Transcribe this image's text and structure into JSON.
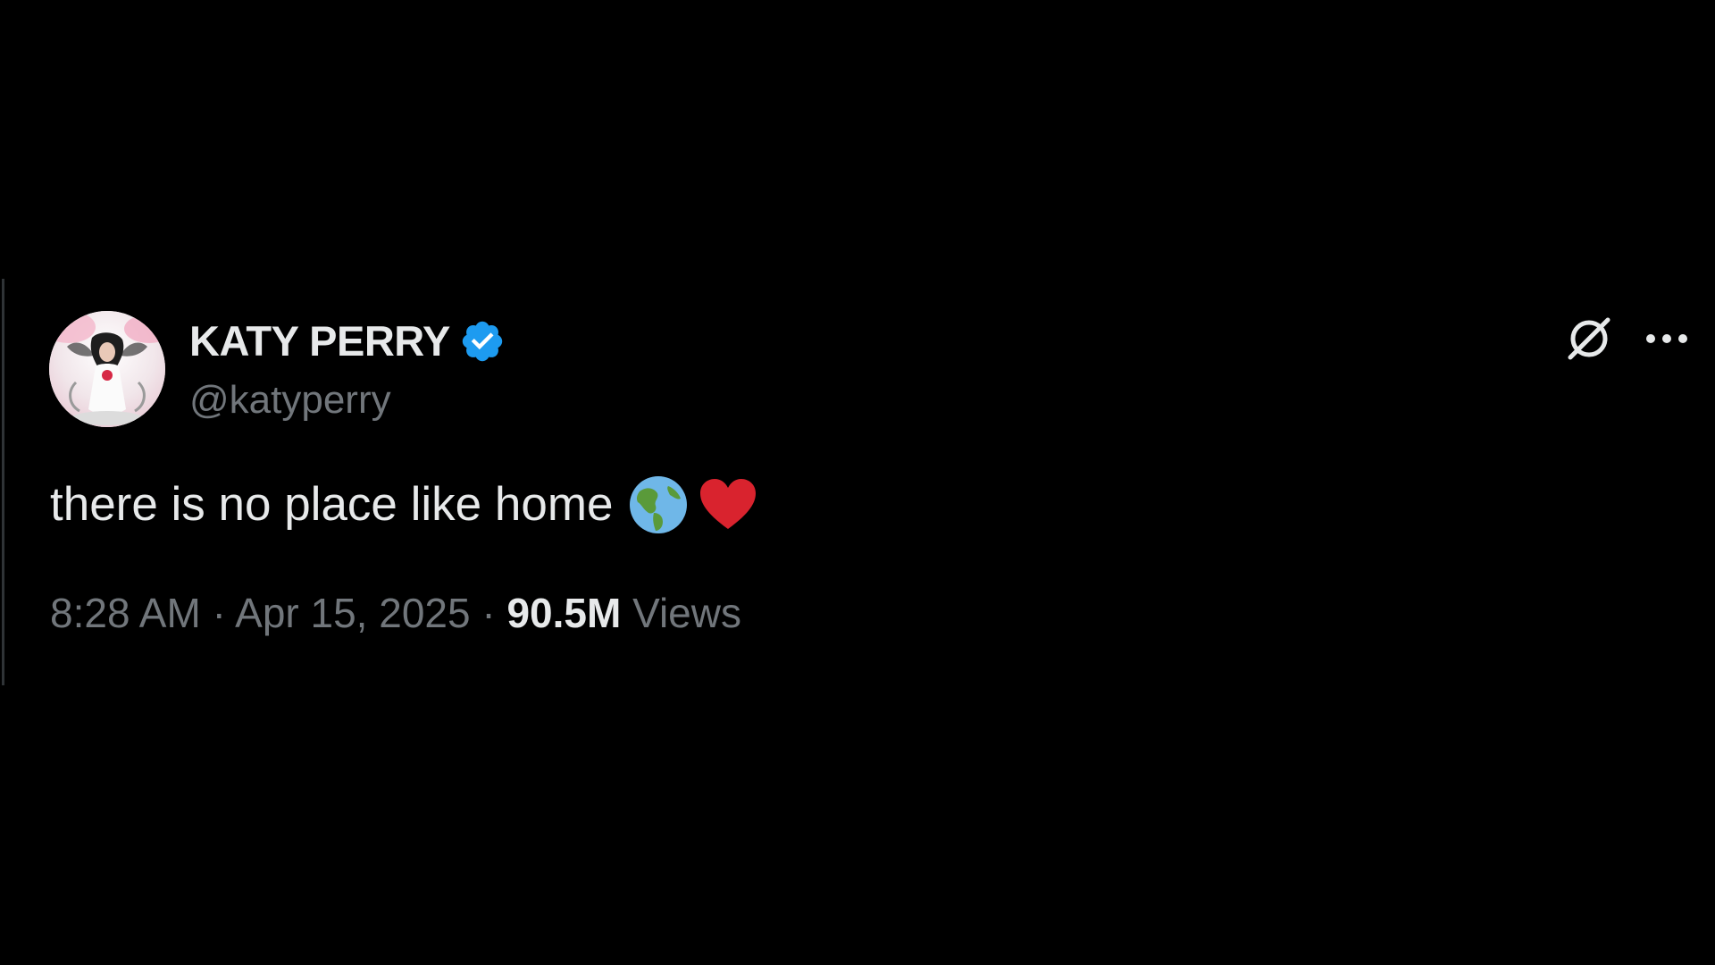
{
  "tweet": {
    "author": {
      "display_name": "KATY PERRY",
      "handle": "@katyperry",
      "verified": true,
      "verified_color": "#1d9bf0",
      "avatar_icon": "profile-photo"
    },
    "text": "there is no place like home",
    "emojis": [
      "globe-americas-icon",
      "red-heart-icon"
    ],
    "time": "8:28 AM",
    "separator": "·",
    "date": "Apr 15, 2025",
    "views_count": "90.5M",
    "views_label": "Views",
    "actions": {
      "grok_icon": "grok-icon",
      "more_icon": "more-icon"
    }
  },
  "colors": {
    "background": "#000000",
    "primary_text": "#e7e9ea",
    "secondary_text": "#71767b"
  }
}
